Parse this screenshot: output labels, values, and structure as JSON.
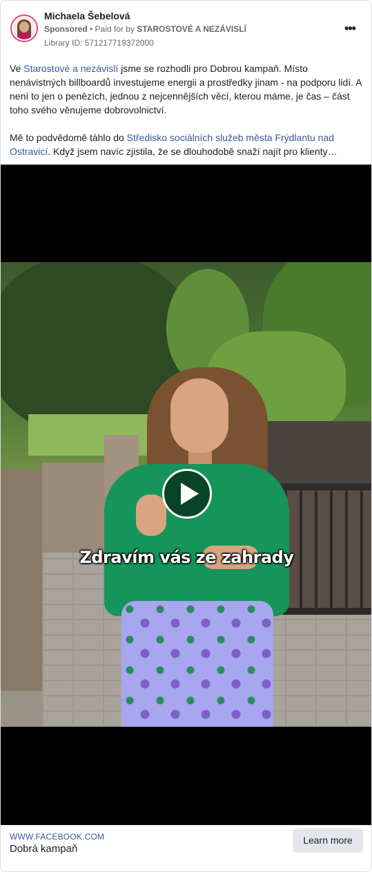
{
  "post": {
    "author_name": "Michaela Šebelová",
    "sponsored_label": "Sponsored",
    "separator": " • ",
    "paid_for_prefix": "Paid for by ",
    "paid_for_by": "STAROSTOVÉ A NEZÁVISLÍ",
    "library_id": "Library ID: 571217719372000",
    "more_icon_text": "•••"
  },
  "body": {
    "p1_before": "Ve ",
    "p1_link": "Starostové a nezávislí",
    "p1_after": " jsme se rozhodli pro Dobrou kampaň. Místo nenávistných billboardů investujeme energii a prostředky jinam - na podporu lidí. A není to jen o penězích, jednou z nejcennějších věcí, kterou máme, je čas – část toho svého věnujeme dobrovolnictví.",
    "p2_before": "Mě to podvědomě táhlo do ",
    "p2_link": "Středisko sociálních služeb města Frýdlantu nad Ostravicí",
    "p2_after": ". Když jsem navíc zjistila, že se dlouhodobě snaží najít pro klienty…"
  },
  "video": {
    "subtitle": "Zdravím vás ze zahrady",
    "play_icon": "play-icon"
  },
  "footer": {
    "domain": "WWW.FACEBOOK.COM",
    "headline": "Dobrá kampaň",
    "cta_label": "Learn more"
  },
  "colors": {
    "link": "#385898",
    "avatar_ring": "#e0447a",
    "cta_bg": "#e4e6eb"
  }
}
